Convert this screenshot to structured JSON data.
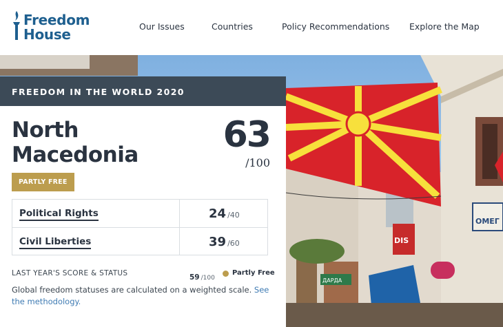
{
  "header": {
    "logo_line1": "Freedom",
    "logo_line2": "House",
    "nav": [
      "Our Issues",
      "Countries",
      "Policy Recommendations",
      "Explore the Map"
    ]
  },
  "card": {
    "heading": "FREEDOM IN THE WORLD 2020",
    "country_line1": "North",
    "country_line2": "Macedonia",
    "total_score": "63",
    "total_max": "/100",
    "status": "PARTLY FREE",
    "categories": [
      {
        "label": "Political Rights",
        "score": "24",
        "max": "/40"
      },
      {
        "label": "Civil Liberties",
        "score": "39",
        "max": "/60"
      }
    ],
    "last_year_label": "LAST YEAR'S SCORE & STATUS",
    "last_year_score": "59",
    "last_year_max": "/100",
    "last_year_status": "Partly Free",
    "note_text": "Global freedom statuses are calculated on a weighted scale.",
    "note_link": "See the methodology."
  },
  "photo_signs": [
    "OMEГ",
    "DIS",
    "ДАРДА"
  ],
  "colors": {
    "brand_blue": "#1e5f8f",
    "card_header": "#3c4a57",
    "partly_free": "#bc9d4e",
    "flag_red": "#d8232a",
    "flag_yellow": "#f7e03c"
  }
}
